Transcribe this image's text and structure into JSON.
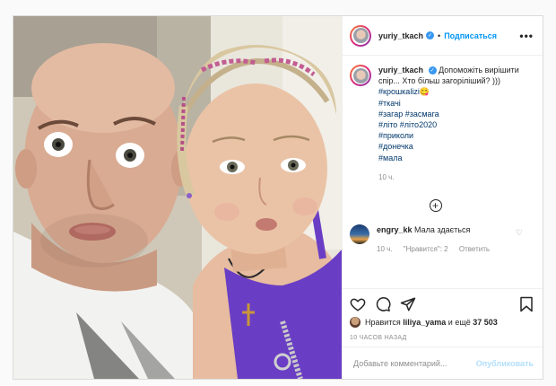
{
  "post": {
    "username": "yuriy_tkach",
    "verified_mark": "✓",
    "separator": "•",
    "follow_label": "Подписаться",
    "more_label": "•••"
  },
  "caption": {
    "username": "yuriy_tkach",
    "text": "Допоможіть вирішити спір... Хто більш загоріліший? )))",
    "tags": [
      "#крошкаlizi😋",
      "#ткачі",
      "#загар #засмага",
      "#літо #літо2020",
      "#приколи",
      "#донечка",
      "#мала"
    ],
    "time": "10 ч."
  },
  "load_more": "+",
  "comment": {
    "username": "engry_kk",
    "text": "Мала здається",
    "time": "10 ч.",
    "likes": "\"Нравится\": 2",
    "reply": "Ответить",
    "heart": "♡"
  },
  "likes": {
    "prefix": "Нравится",
    "user": "liliya_yama",
    "suffix": "и ещё",
    "count": "37 503"
  },
  "posted_ago": "10 ЧАСОВ НАЗАД",
  "add_comment": {
    "placeholder": "Добавьте комментарий...",
    "publish_label": "Опубликовать"
  },
  "colors": {
    "accent": "#0095f6",
    "link": "#00376b",
    "muted": "#8e8e8e",
    "publish_disabled": "#b2dffc"
  },
  "icons": [
    "heart-icon",
    "comment-icon",
    "share-icon",
    "bookmark-icon",
    "verified-icon",
    "more-icon",
    "plus-circle-icon"
  ]
}
